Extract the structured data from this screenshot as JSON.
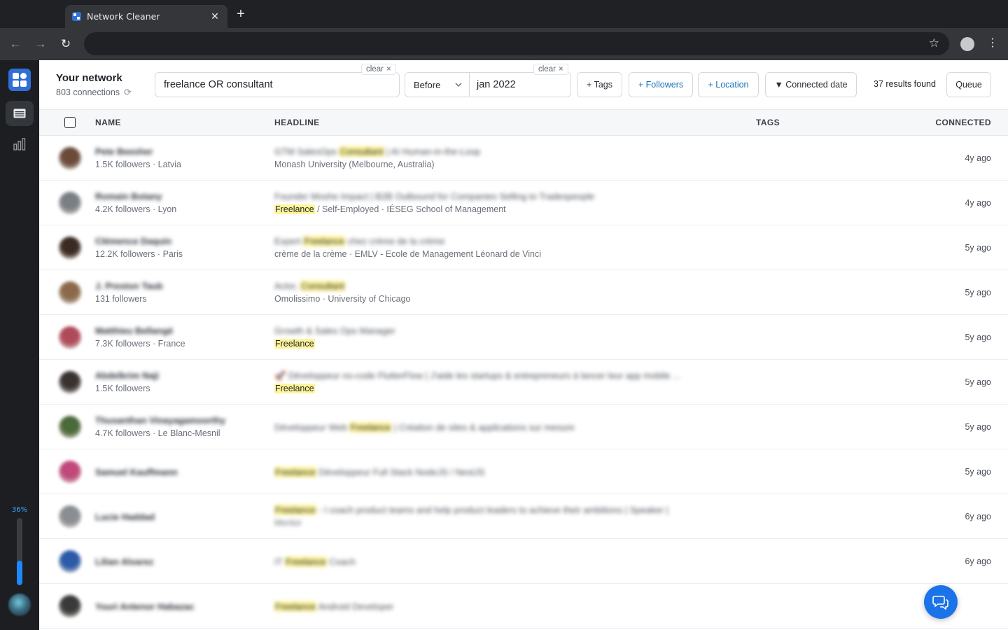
{
  "browser": {
    "tab_title": "Network Cleaner",
    "tab_close": "✕",
    "new_tab": "+",
    "back": "←",
    "forward": "→",
    "reload": "↻",
    "bookmark": "☆",
    "menu": "⋮"
  },
  "sidebar": {
    "progress_label": "36%",
    "progress_value": 0.36,
    "icons": [
      "logo-icon",
      "table-icon",
      "bar-chart-icon"
    ]
  },
  "network": {
    "title": "Your network",
    "connections": "803 connections"
  },
  "search": {
    "value": "freelance OR consultant",
    "clear_label": "clear"
  },
  "date_filter": {
    "operator": "Before",
    "value": "jan 2022",
    "clear_label": "clear"
  },
  "filters": {
    "tags": "+ Tags",
    "followers": "+ Followers",
    "location": "+ Location",
    "connected_date": "▼ Connected date"
  },
  "results": "37 results found",
  "queue_label": "Queue",
  "columns": {
    "name": "NAME",
    "headline": "HEADLINE",
    "tags": "TAGS",
    "connected": "CONNECTED"
  },
  "rows": [
    {
      "name": "Pete Beesher",
      "meta": "1.5K followers · Latvia",
      "headline_pre": "GTM SalesOps ",
      "headline_hl": "Consultant",
      "headline_post": " | AI Human-in-the-Loop",
      "headline2_hl": "",
      "headline2": "Monash University (Melbourne, Australia)",
      "connected": "4y ago",
      "avatar": "#6b4a3a"
    },
    {
      "name": "Romain Botany",
      "meta": "4.2K followers · Lyon",
      "headline_pre": "Founder Moshe Impact | B2B Outbound for Companies Selling to Tradespeople",
      "headline_hl": "",
      "headline_post": "",
      "headline2_hl": "Freelance",
      "headline2": " / Self-Employed · IÉSEG School of Management",
      "connected": "4y ago",
      "avatar": "#7a7f86"
    },
    {
      "name": "Clémence Daquin",
      "meta": "12.2K followers · Paris",
      "headline_pre": "Expert ",
      "headline_hl": "Freelance",
      "headline_post": " chez crème de la crème",
      "headline2_hl": "",
      "headline2": "crème de la crème · EMLV - Ecole de Management Léonard de Vinci",
      "connected": "5y ago",
      "avatar": "#3a2a22"
    },
    {
      "name": "J. Preston Taub",
      "meta": "131 followers",
      "headline_pre": "Actor, ",
      "headline_hl": "Consultant",
      "headline_post": "",
      "headline2_hl": "",
      "headline2": "Omolissimo · University of Chicago",
      "connected": "5y ago",
      "avatar": "#8a6a4a"
    },
    {
      "name": "Matthieu Bellangé",
      "meta": "7.3K followers · France",
      "headline_pre": "Growth & Sales Ops Manager",
      "headline_hl": "",
      "headline_post": "",
      "headline2_hl": "Freelance",
      "headline2": "",
      "connected": "5y ago",
      "avatar": "#b04a5a"
    },
    {
      "name": "Abdelkrim Naji",
      "meta": "1.5K followers",
      "headline_pre": "🚀 Développeur no-code FlutterFlow | J'aide les startups & entrepreneurs à lancer leur app mobile ...",
      "headline_hl": "",
      "headline_post": "",
      "headline2_hl": "Freelance",
      "headline2": "",
      "connected": "5y ago",
      "avatar": "#3a3230"
    },
    {
      "name": "Thusanthan Vinayagamoorthy",
      "meta": "4.7K followers · Le Blanc-Mesnil",
      "headline_pre": "Développeur Web ",
      "headline_hl": "Freelance",
      "headline_post": " | Création de sites & applications sur mesure",
      "headline2_hl": "",
      "headline2": "",
      "connected": "5y ago",
      "avatar": "#4a6a3a"
    },
    {
      "name": "Samuel Kauffmann",
      "meta": "",
      "headline_pre": "",
      "headline_hl": "Freelance",
      "headline_post": " Développeur Full Stack NodeJS / NestJS",
      "headline2_hl": "",
      "headline2": "",
      "connected": "5y ago",
      "avatar": "#c0487a"
    },
    {
      "name": "Lucie Haddad",
      "meta": "",
      "headline_pre": "",
      "headline_hl": "Freelance",
      "headline_post": " - I coach product teams and help product leaders to achieve their ambitions | Speaker |",
      "headline2_hl": "",
      "headline2": "Mentor",
      "connected": "6y ago",
      "avatar": "#8a8d92"
    },
    {
      "name": "Lilian Alvarez",
      "meta": "",
      "headline_pre": "IT ",
      "headline_hl": "Freelance",
      "headline_post": " Coach",
      "headline2_hl": "",
      "headline2": "",
      "connected": "6y ago",
      "avatar": "#2a5aa8"
    },
    {
      "name": "Youri Antenor Habazac",
      "meta": "",
      "headline_pre": "",
      "headline_hl": "Freelance",
      "headline_post": " Android Developer",
      "headline2_hl": "",
      "headline2": "",
      "connected": "",
      "avatar": "#3a3a3a"
    }
  ]
}
